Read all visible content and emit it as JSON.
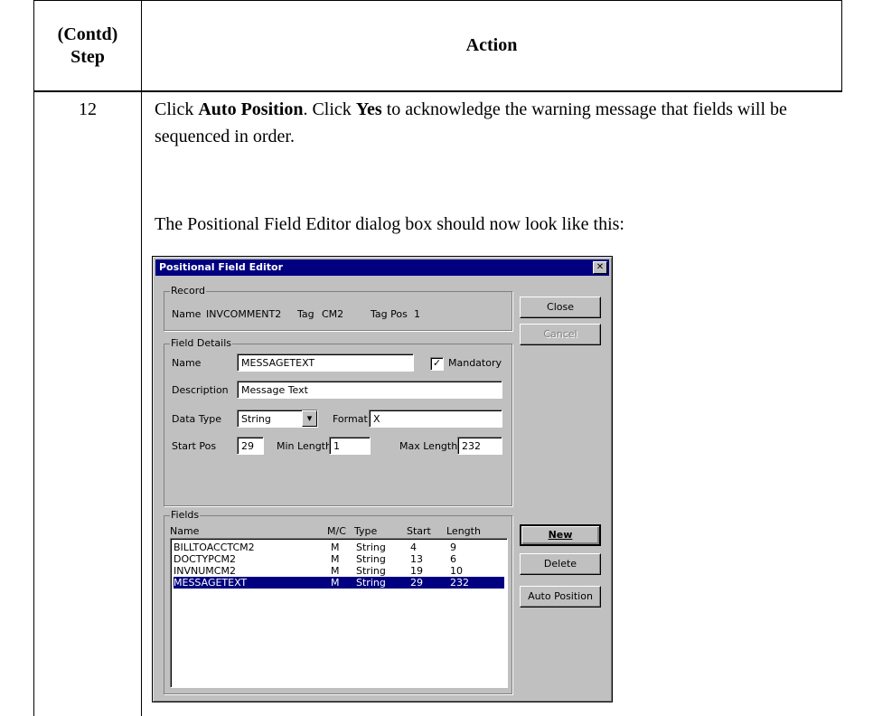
{
  "table": {
    "header_step": "(Contd)\nStep",
    "header_step_line1": "(Contd)",
    "header_step_line2": "Step",
    "header_action": "Action",
    "step_number": "12",
    "instruction": {
      "text1": "Click ",
      "bold1": "Auto Position",
      "text2": ". Click ",
      "bold2": "Yes",
      "text3": " to acknowledge the warning message that fields will be sequenced in order."
    },
    "instruction2": "The Positional Field Editor dialog box should now look like this:"
  },
  "dialog": {
    "title": "Positional Field Editor",
    "close_glyph": "✕",
    "record": {
      "group_label": "Record",
      "name_label": "Name",
      "name_value": "INVCOMMENT2",
      "tag_label": "Tag",
      "tag_value": "CM2",
      "tagpos_label": "Tag Pos",
      "tagpos_value": "1"
    },
    "field_details": {
      "group_label": "Field Details",
      "name_label": "Name",
      "name_value": "MESSAGETEXT",
      "mandatory_label": "Mandatory",
      "mandatory_checked": true,
      "description_label": "Description",
      "description_value": "Message Text",
      "datatype_label": "Data Type",
      "datatype_value": "String",
      "format_label": "Format",
      "format_value": "X",
      "startpos_label": "Start Pos",
      "startpos_value": "29",
      "minlength_label": "Min Length",
      "minlength_value": "1",
      "maxlength_label": "Max Length",
      "maxlength_value": "232"
    },
    "fields": {
      "group_label": "Fields",
      "columns": [
        "Name",
        "M/C",
        "Type",
        "Start",
        "Length"
      ],
      "rows": [
        {
          "name": "BILLTOACCTCM2",
          "mc": "M",
          "type": "String",
          "start": "4",
          "length": "9"
        },
        {
          "name": "DOCTYPCM2",
          "mc": "M",
          "type": "String",
          "start": "13",
          "length": "6"
        },
        {
          "name": "INVNUMCM2",
          "mc": "M",
          "type": "String",
          "start": "19",
          "length": "10"
        },
        {
          "name": "MESSAGETEXT",
          "mc": "M",
          "type": "String",
          "start": "29",
          "length": "232"
        }
      ],
      "selected_index": 3
    },
    "buttons": {
      "close": "Close",
      "cancel": "Cancel",
      "new": "New",
      "delete": "Delete",
      "auto_position": "Auto Position"
    }
  }
}
